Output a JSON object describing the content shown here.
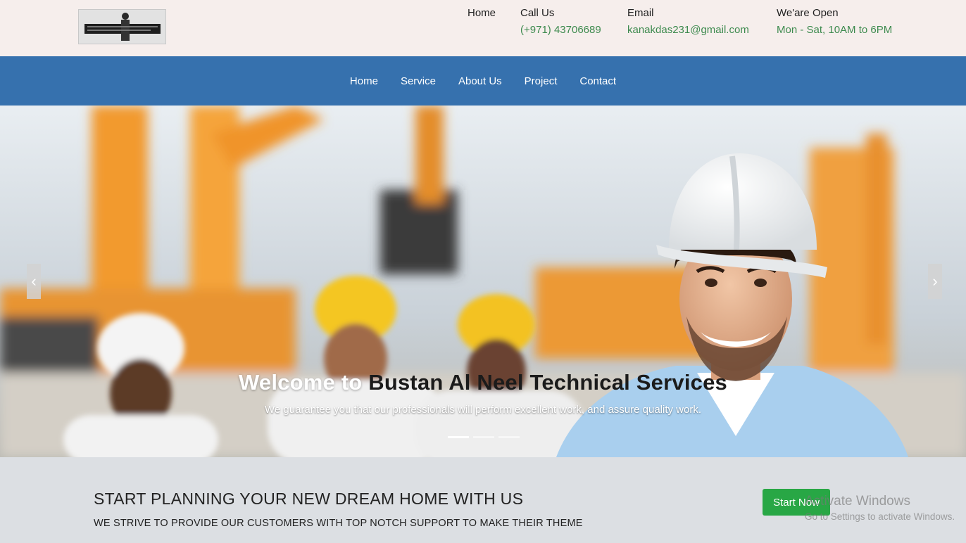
{
  "topbar": {
    "home_label": "Home",
    "call": {
      "label": "Call Us",
      "value": "(+971) 43706689"
    },
    "email": {
      "label": "Email",
      "value": "kanakdas231@gmail.com"
    },
    "open": {
      "label": "We'are Open",
      "value": "Mon - Sat, 10AM to 6PM"
    }
  },
  "nav": {
    "items": [
      {
        "label": "Home"
      },
      {
        "label": "Service"
      },
      {
        "label": "About Us"
      },
      {
        "label": "Project"
      },
      {
        "label": "Contact"
      }
    ]
  },
  "hero": {
    "title_part1": "Welcome to ",
    "title_part2": "Bustan Al Neel Technical Services",
    "subtitle": "We guarantee you that our professionals will perform excellent work, and assure quality work.",
    "prev_icon": "chevron-left-icon",
    "next_icon": "chevron-right-icon",
    "prev_glyph": "‹",
    "next_glyph": "›"
  },
  "cta": {
    "title": "START PLANNING YOUR NEW DREAM HOME WITH US",
    "subtitle": "WE STRIVE TO PROVIDE OUR CUSTOMERS WITH TOP NOTCH SUPPORT TO MAKE THEIR THEME",
    "button_label": "Start Now"
  },
  "watermark": {
    "title": "Activate Windows",
    "subtitle": "Go to Settings to activate Windows."
  },
  "colors": {
    "topbar_bg": "#f6eeec",
    "nav_bg": "#3671ae",
    "accent_green": "#3d8a4e",
    "button_green": "#28a745",
    "cta_bg": "#dcdfe3"
  }
}
